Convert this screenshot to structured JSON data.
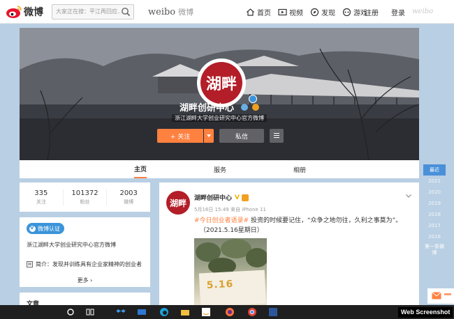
{
  "topnav": {
    "logo_text": "微博",
    "search_placeholder": "大家正在搜：平江再回应...",
    "brand_en": "weibo",
    "brand_cn": "微博",
    "links": [
      {
        "label": "首页",
        "icon": "home-icon"
      },
      {
        "label": "视频",
        "icon": "video-icon"
      },
      {
        "label": "发现",
        "icon": "discover-icon"
      },
      {
        "label": "游戏",
        "icon": "game-icon"
      }
    ],
    "register": "注册",
    "login": "登录",
    "weibo_right": "weibo"
  },
  "profile": {
    "avatar_text": "湖畔",
    "name": "湖畔创研中心",
    "description": "浙江湖畔大学创业研究中心官方微博",
    "follow_label": "+ 关注",
    "message_label": "私信"
  },
  "tabs": [
    "主页",
    "服务",
    "相册"
  ],
  "years": {
    "recent": "最近",
    "list": [
      "2021",
      "2020",
      "2019",
      "2018",
      "2017",
      "2016"
    ],
    "back": "第一条微博"
  },
  "stats": [
    {
      "value": "335",
      "label": "关注"
    },
    {
      "value": "101372",
      "label": "粉丝"
    },
    {
      "value": "2003",
      "label": "微博"
    }
  ],
  "info": {
    "verify_chip": "微博认证",
    "verify_text": "浙江湖畔大学创业研究中心官方微博",
    "intro_label": "简介：",
    "intro_text": "发现并训练具有企业家精神的创业者",
    "more": "更多 ›",
    "docs": "文章"
  },
  "post": {
    "avatar_text": "湖畔",
    "name": "湖畔创研中心",
    "meta": "5月16日 15:49 来自 iPhone 11",
    "hashtag": "#今日创业者语录#",
    "text": " 投资的时候要记住，“众争之地勿往，久利之事莫为”。",
    "date": "（2021.5.16星期日）",
    "image_number": "5.16"
  },
  "watermark": "Web Screenshot",
  "colors": {
    "accent": "#ff8140",
    "verify_blue": "#3b94d9",
    "brand_red": "#b31e28"
  }
}
